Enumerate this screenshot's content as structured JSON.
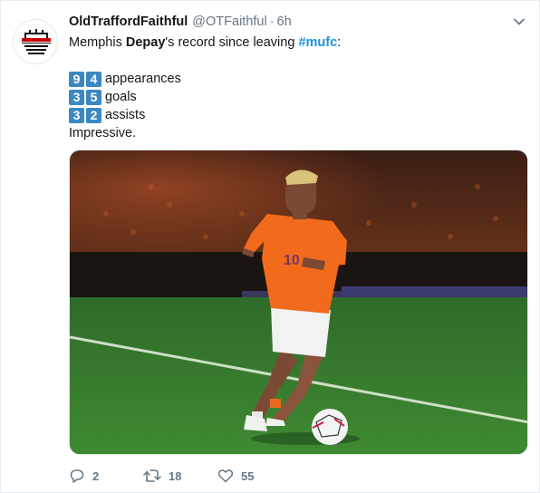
{
  "tweet": {
    "display_name": "OldTraffordFaithful",
    "handle": "@OTFaithful",
    "separator": "·",
    "time": "6h",
    "avatar_text": "OLD TRAFFORD FAITHFUL",
    "text_pre": "Memphis ",
    "text_bold": "Depay",
    "text_mid": "'s record since leaving ",
    "hashtag": "#mufc",
    "text_end": ":",
    "stats": [
      {
        "digits": [
          "9",
          "4"
        ],
        "label": "appearances"
      },
      {
        "digits": [
          "3",
          "5"
        ],
        "label": "goals"
      },
      {
        "digits": [
          "3",
          "2"
        ],
        "label": "assists"
      }
    ],
    "closing": "Impressive.",
    "media_icon": "football-player-photo"
  },
  "actions": {
    "replies": "2",
    "retweets": "18",
    "likes": "55",
    "reply_icon": "reply-icon",
    "retweet_icon": "retweet-icon",
    "like_icon": "heart-icon"
  },
  "colors": {
    "link": "#1b95e0",
    "keycap": "#3b88c3",
    "muted": "#657786",
    "text": "#14171a"
  }
}
